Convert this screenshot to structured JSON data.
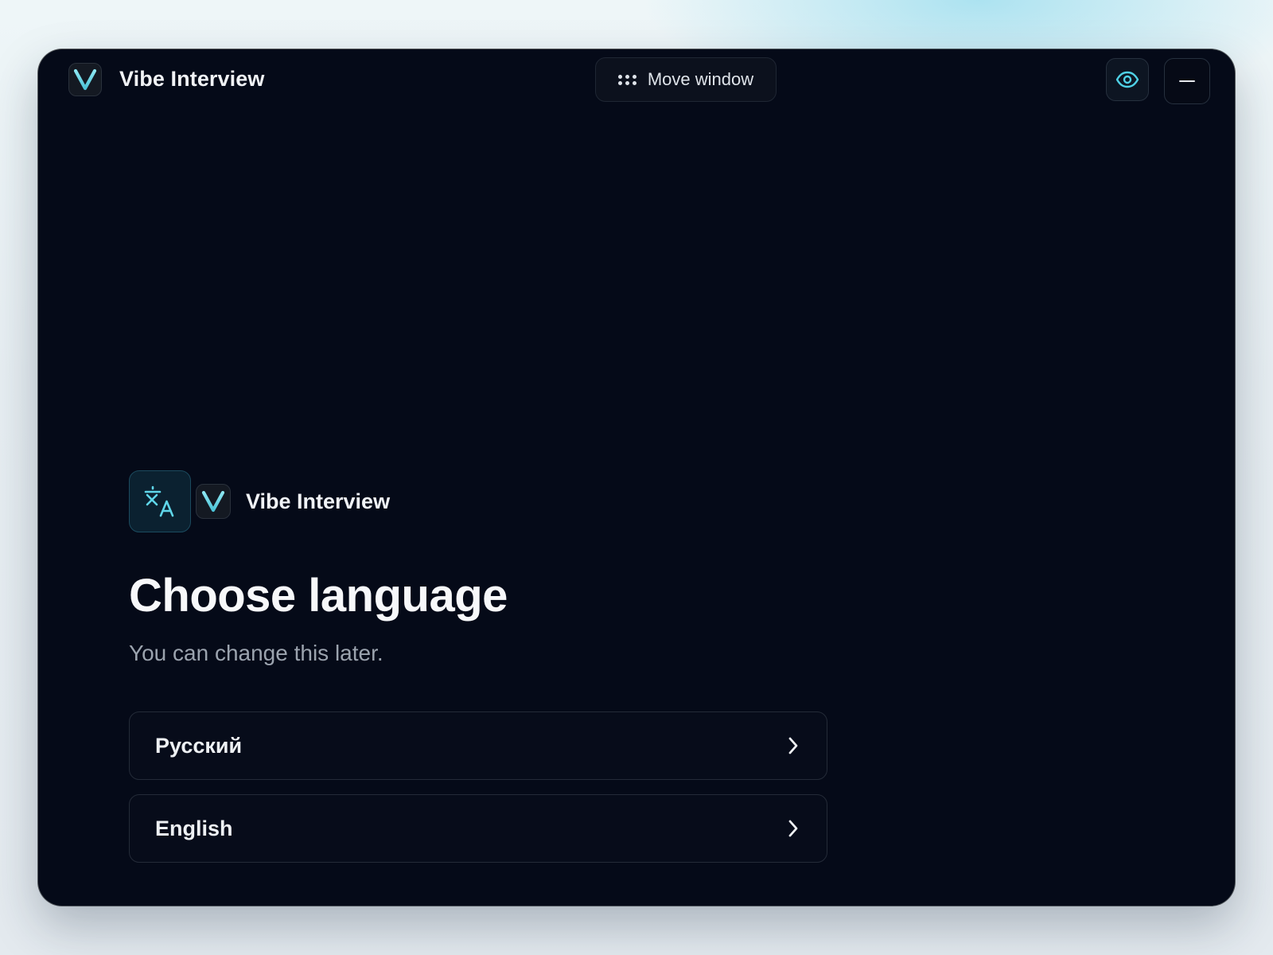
{
  "titlebar": {
    "app_name": "Vibe Interview",
    "move_button_label": "Move window",
    "eye_icon": "eye-icon",
    "minimize_icon": "minus-icon",
    "logo_icon": "v-logo-icon"
  },
  "onboarding": {
    "brand_name": "Vibe Interview",
    "translate_icon": "translate-icon",
    "heading": "Choose language",
    "subtitle": "You can change this later.",
    "languages": [
      {
        "label": "Русский",
        "icon": "chevron-right-icon"
      },
      {
        "label": "English",
        "icon": "chevron-right-icon"
      }
    ]
  },
  "colors": {
    "window_background": "#050a18",
    "accent": "#5ed3e6",
    "text_primary": "#f1f3f6",
    "text_secondary": "#9ba3ae"
  }
}
